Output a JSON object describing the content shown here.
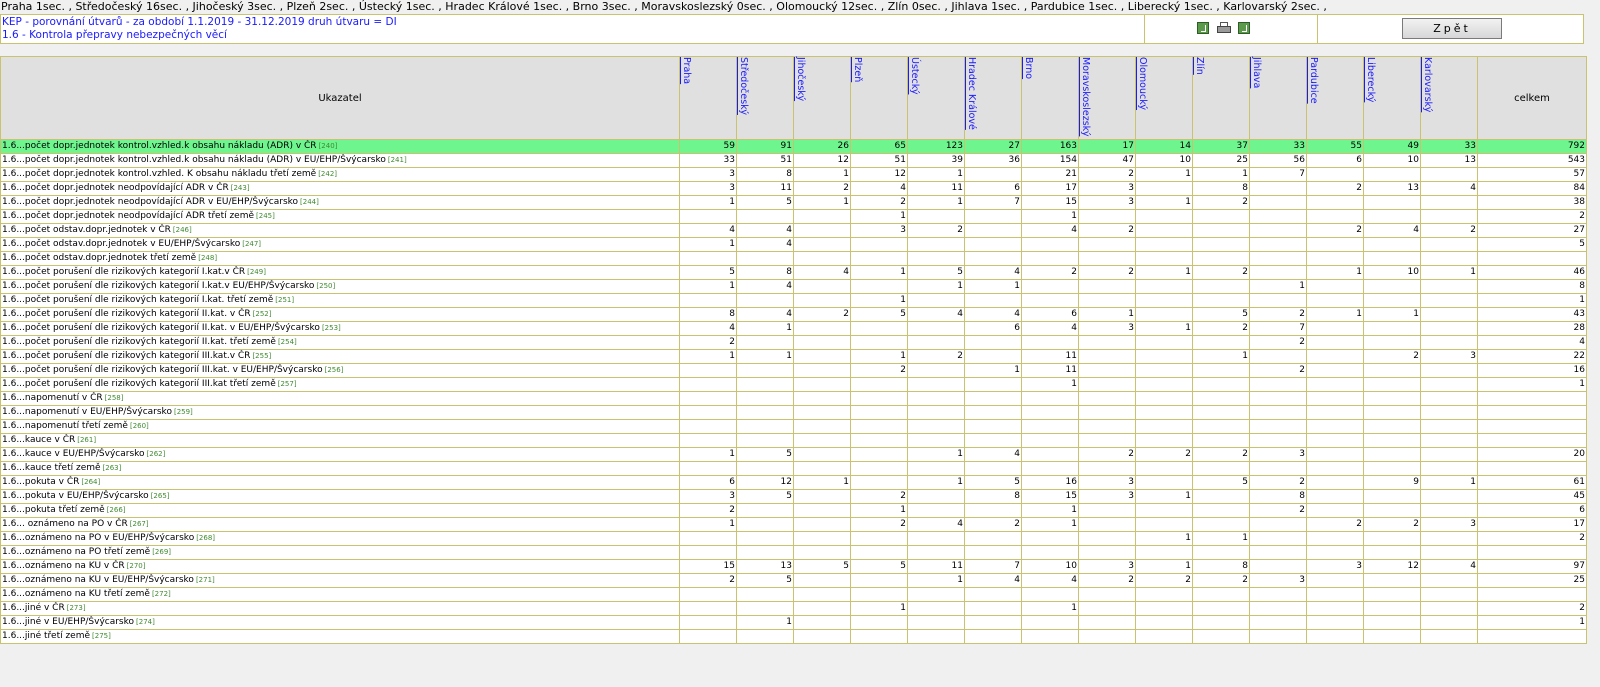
{
  "summary_line": "Praha 1sec. , Středočeský 16sec. , Jihočeský 3sec. , Plzeň 2sec. , Ústecký 1sec. , Hradec Králové 1sec. , Brno 3sec. , Moravskoslezský 0sec. , Olomoucký 12sec. , Zlín 0sec. , Jihlava 1sec. , Pardubice 1sec. , Liberecký 1sec. , Karlovarský 2sec. ,",
  "header": {
    "line1": "KEP - porovnání útvarů - za období 1.1.2019 - 31.12.2019 druh útvaru = DI",
    "line2": "1.6 - Kontrola přepravy nebezpečných věcí",
    "back_label": "Zpět",
    "icons": [
      "excel-export-icon",
      "printer-icon",
      "excel-export-icon"
    ]
  },
  "table": {
    "indicator_header": "Ukazatel",
    "total_header": "celkem",
    "regions": [
      "Praha",
      "Středočeský",
      "Jihočeský",
      "Plzeň",
      "Ústecký",
      "Hradec Králové",
      "Brno",
      "Moravskoslezský",
      "Olomoucký",
      "Zlín",
      "Jihlava",
      "Pardubice",
      "Liberecký",
      "Karlovarský"
    ],
    "highlight_color": "#6ef58e",
    "rows": [
      {
        "label": "1.6...počet dopr.jednotek kontrol.vzhled.k obsahu nákladu (ADR) v ČR",
        "code": "[240]",
        "values": [
          "59",
          "91",
          "26",
          "65",
          "123",
          "27",
          "163",
          "17",
          "14",
          "37",
          "33",
          "55",
          "49",
          "33"
        ],
        "total": "792",
        "highlight": true
      },
      {
        "label": "1.6...počet dopr.jednotek kontrol.vzhled.k obsahu nákladu (ADR) v EU/EHP/Švýcarsko",
        "code": "[241]",
        "values": [
          "33",
          "51",
          "12",
          "51",
          "39",
          "36",
          "154",
          "47",
          "10",
          "25",
          "56",
          "6",
          "10",
          "13"
        ],
        "total": "543"
      },
      {
        "label": "1.6...počet dopr.jednotek kontrol.vzhled. K obsahu nákladu třetí země",
        "code": "[242]",
        "values": [
          "3",
          "8",
          "1",
          "12",
          "1",
          "",
          "21",
          "2",
          "1",
          "1",
          "7",
          "",
          "",
          ""
        ],
        "total": "57"
      },
      {
        "label": "1.6...počet dopr.jednotek neodpovídající ADR v ČR",
        "code": "[243]",
        "values": [
          "3",
          "11",
          "2",
          "4",
          "11",
          "6",
          "17",
          "3",
          "",
          "8",
          "",
          "2",
          "13",
          "4"
        ],
        "total": "84"
      },
      {
        "label": "1.6...počet dopr.jednotek neodpovídající ADR v EU/EHP/Švýcarsko",
        "code": "[244]",
        "values": [
          "1",
          "5",
          "1",
          "2",
          "1",
          "7",
          "15",
          "3",
          "1",
          "2",
          "",
          "",
          "",
          ""
        ],
        "total": "38"
      },
      {
        "label": "1.6...počet dopr.jednotek neodpovídající ADR třetí země",
        "code": "[245]",
        "values": [
          "",
          "",
          "",
          "1",
          "",
          "",
          "1",
          "",
          "",
          "",
          "",
          "",
          "",
          ""
        ],
        "total": "2"
      },
      {
        "label": "1.6...počet odstav.dopr.jednotek v ČR",
        "code": "[246]",
        "values": [
          "4",
          "4",
          "",
          "3",
          "2",
          "",
          "4",
          "2",
          "",
          "",
          "",
          "2",
          "4",
          "2"
        ],
        "total": "27"
      },
      {
        "label": "1.6...počet odstav.dopr.jednotek v EU/EHP/Švýcarsko",
        "code": "[247]",
        "values": [
          "1",
          "4",
          "",
          "",
          "",
          "",
          "",
          "",
          "",
          "",
          "",
          "",
          "",
          ""
        ],
        "total": "5"
      },
      {
        "label": "1.6...počet odstav.dopr.jednotek třetí země",
        "code": "[248]",
        "values": [
          "",
          "",
          "",
          "",
          "",
          "",
          "",
          "",
          "",
          "",
          "",
          "",
          "",
          ""
        ],
        "total": ""
      },
      {
        "label": "1.6...počet porušení dle rizikových kategorií I.kat.v ČR",
        "code": "[249]",
        "values": [
          "5",
          "8",
          "4",
          "1",
          "5",
          "4",
          "2",
          "2",
          "1",
          "2",
          "",
          "1",
          "10",
          "1"
        ],
        "total": "46"
      },
      {
        "label": "1.6...počet porušení dle rizikových kategorií I.kat.v EU/EHP/Švýcarsko",
        "code": "[250]",
        "values": [
          "1",
          "4",
          "",
          "",
          "1",
          "1",
          "",
          "",
          "",
          "",
          "1",
          "",
          "",
          ""
        ],
        "total": "8"
      },
      {
        "label": "1.6...počet porušení dle rizikových kategorií I.kat. třetí země",
        "code": "[251]",
        "values": [
          "",
          "",
          "",
          "1",
          "",
          "",
          "",
          "",
          "",
          "",
          "",
          "",
          "",
          ""
        ],
        "total": "1"
      },
      {
        "label": "1.6...počet porušení dle rizikových kategorií II.kat. v ČR",
        "code": "[252]",
        "values": [
          "8",
          "4",
          "2",
          "5",
          "4",
          "4",
          "6",
          "1",
          "",
          "5",
          "2",
          "1",
          "1",
          ""
        ],
        "total": "43"
      },
      {
        "label": "1.6...počet porušení dle rizikových kategorií II.kat. v EU/EHP/Švýcarsko",
        "code": "[253]",
        "values": [
          "4",
          "1",
          "",
          "",
          "",
          "6",
          "4",
          "3",
          "1",
          "2",
          "7",
          "",
          "",
          ""
        ],
        "total": "28"
      },
      {
        "label": "1.6...počet porušení dle rizikových kategorií II.kat. třetí země",
        "code": "[254]",
        "values": [
          "2",
          "",
          "",
          "",
          "",
          "",
          "",
          "",
          "",
          "",
          "2",
          "",
          "",
          ""
        ],
        "total": "4"
      },
      {
        "label": "1.6...počet porušení dle rizikových kategorií III.kat.v ČR",
        "code": "[255]",
        "values": [
          "1",
          "1",
          "",
          "1",
          "2",
          "",
          "11",
          "",
          "",
          "1",
          "",
          "",
          "2",
          "3"
        ],
        "total": "22"
      },
      {
        "label": "1.6...počet porušení dle rizikových kategorií III.kat. v EU/EHP/Švýcarsko",
        "code": "[256]",
        "values": [
          "",
          "",
          "",
          "2",
          "",
          "1",
          "11",
          "",
          "",
          "",
          "2",
          "",
          "",
          ""
        ],
        "total": "16"
      },
      {
        "label": "1.6...počet porušení dle rizikových kategorií III.kat třetí země",
        "code": "[257]",
        "values": [
          "",
          "",
          "",
          "",
          "",
          "",
          "1",
          "",
          "",
          "",
          "",
          "",
          "",
          ""
        ],
        "total": "1"
      },
      {
        "label": "1.6...napomenutí v ČR",
        "code": "[258]",
        "values": [
          "",
          "",
          "",
          "",
          "",
          "",
          "",
          "",
          "",
          "",
          "",
          "",
          "",
          ""
        ],
        "total": ""
      },
      {
        "label": "1.6...napomenutí v EU/EHP/Švýcarsko",
        "code": "[259]",
        "values": [
          "",
          "",
          "",
          "",
          "",
          "",
          "",
          "",
          "",
          "",
          "",
          "",
          "",
          ""
        ],
        "total": ""
      },
      {
        "label": "1.6...napomenutí třetí země",
        "code": "[260]",
        "values": [
          "",
          "",
          "",
          "",
          "",
          "",
          "",
          "",
          "",
          "",
          "",
          "",
          "",
          ""
        ],
        "total": ""
      },
      {
        "label": "1.6...kauce v ČR",
        "code": "[261]",
        "values": [
          "",
          "",
          "",
          "",
          "",
          "",
          "",
          "",
          "",
          "",
          "",
          "",
          "",
          ""
        ],
        "total": ""
      },
      {
        "label": "1.6...kauce v EU/EHP/Švýcarsko",
        "code": "[262]",
        "values": [
          "1",
          "5",
          "",
          "",
          "1",
          "4",
          "",
          "2",
          "2",
          "2",
          "3",
          "",
          "",
          ""
        ],
        "total": "20"
      },
      {
        "label": "1.6...kauce třetí země",
        "code": "[263]",
        "values": [
          "",
          "",
          "",
          "",
          "",
          "",
          "",
          "",
          "",
          "",
          "",
          "",
          "",
          ""
        ],
        "total": ""
      },
      {
        "label": "1.6...pokuta v ČR",
        "code": "[264]",
        "values": [
          "6",
          "12",
          "1",
          "",
          "1",
          "5",
          "16",
          "3",
          "",
          "5",
          "2",
          "",
          "9",
          "1"
        ],
        "total": "61"
      },
      {
        "label": "1.6...pokuta v EU/EHP/Švýcarsko",
        "code": "[265]",
        "values": [
          "3",
          "5",
          "",
          "2",
          "",
          "8",
          "15",
          "3",
          "1",
          "",
          "8",
          "",
          "",
          ""
        ],
        "total": "45"
      },
      {
        "label": "1.6...pokuta třetí země",
        "code": "[266]",
        "values": [
          "2",
          "",
          "",
          "1",
          "",
          "",
          "1",
          "",
          "",
          "",
          "2",
          "",
          "",
          ""
        ],
        "total": "6"
      },
      {
        "label": "1.6... oznámeno na PO v ČR",
        "code": "[267]",
        "values": [
          "1",
          "",
          "",
          "2",
          "4",
          "2",
          "1",
          "",
          "",
          "",
          "",
          "2",
          "2",
          "3"
        ],
        "total": "17"
      },
      {
        "label": "1.6...oznámeno na PO v EU/EHP/Švýcarsko",
        "code": "[268]",
        "values": [
          "",
          "",
          "",
          "",
          "",
          "",
          "",
          "",
          "1",
          "1",
          "",
          "",
          "",
          ""
        ],
        "total": "2"
      },
      {
        "label": "1.6...oznámeno na PO třetí země",
        "code": "[269]",
        "values": [
          "",
          "",
          "",
          "",
          "",
          "",
          "",
          "",
          "",
          "",
          "",
          "",
          "",
          ""
        ],
        "total": ""
      },
      {
        "label": "1.6...oznámeno na KU v ČR",
        "code": "[270]",
        "values": [
          "15",
          "13",
          "5",
          "5",
          "11",
          "7",
          "10",
          "3",
          "1",
          "8",
          "",
          "3",
          "12",
          "4"
        ],
        "total": "97"
      },
      {
        "label": "1.6...oznámeno na KU v EU/EHP/Švýcarsko",
        "code": "[271]",
        "values": [
          "2",
          "5",
          "",
          "",
          "1",
          "4",
          "4",
          "2",
          "2",
          "2",
          "3",
          "",
          "",
          ""
        ],
        "total": "25"
      },
      {
        "label": "1.6...oznámeno na KU třetí země",
        "code": "[272]",
        "values": [
          "",
          "",
          "",
          "",
          "",
          "",
          "",
          "",
          "",
          "",
          "",
          "",
          "",
          ""
        ],
        "total": ""
      },
      {
        "label": "1.6...jiné v ČR",
        "code": "[273]",
        "values": [
          "",
          "",
          "",
          "1",
          "",
          "",
          "1",
          "",
          "",
          "",
          "",
          "",
          "",
          ""
        ],
        "total": "2"
      },
      {
        "label": "1.6...jiné v EU/EHP/Švýcarsko",
        "code": "[274]",
        "values": [
          "",
          "1",
          "",
          "",
          "",
          "",
          "",
          "",
          "",
          "",
          "",
          "",
          "",
          ""
        ],
        "total": "1"
      },
      {
        "label": "1.6...jiné třetí země",
        "code": "[275]",
        "values": [
          "",
          "",
          "",
          "",
          "",
          "",
          "",
          "",
          "",
          "",
          "",
          "",
          "",
          ""
        ],
        "total": ""
      }
    ]
  }
}
